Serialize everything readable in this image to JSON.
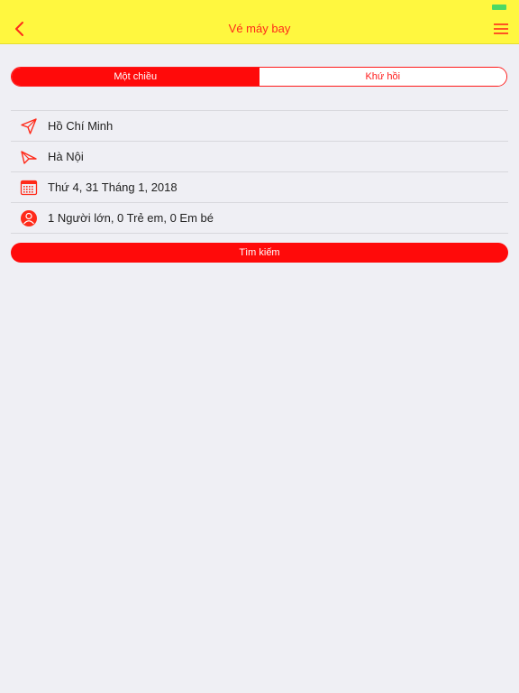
{
  "nav": {
    "title": "Vé máy bay",
    "back_icon": "chevron-left-icon",
    "menu_icon": "hamburger-menu-icon"
  },
  "trip_type": {
    "one_way": "Một chiều",
    "round_trip": "Khứ hồi",
    "selected": "one_way"
  },
  "form": {
    "origin": "Hồ Chí Minh",
    "destination": "Hà Nội",
    "date": "Thứ 4, 31 Tháng 1, 2018",
    "passengers": "1 Người lớn, 0 Trẻ em, 0 Em bé"
  },
  "search": {
    "label": "Tìm kiếm"
  },
  "colors": {
    "nav_background": "#fff73f",
    "accent": "#ff0a0a",
    "background": "#efeff4",
    "battery": "#4cd964"
  }
}
